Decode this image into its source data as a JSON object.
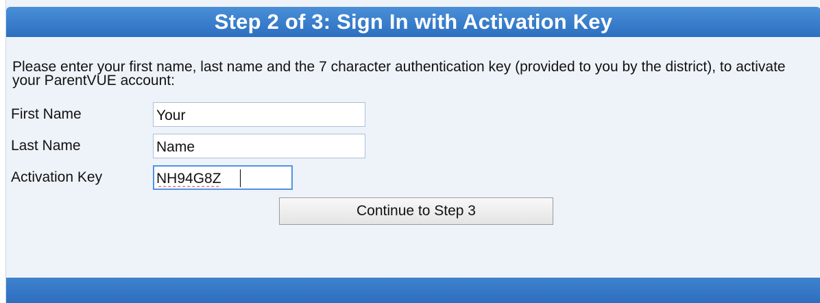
{
  "header": {
    "title": "Step 2 of 3: Sign In with Activation Key"
  },
  "instructions": "Please enter your first name, last name and the 7 character authentication key (provided to you by the district), to activate your ParentVUE account:",
  "form": {
    "first_name": {
      "label": "First Name",
      "value": "Your"
    },
    "last_name": {
      "label": "Last Name",
      "value": "Name"
    },
    "activation_key": {
      "label": "Activation Key",
      "value": "NH94G8Z"
    }
  },
  "buttons": {
    "continue_label": "Continue to Step 3"
  },
  "colors": {
    "header": "#3a7fcd",
    "panel_background": "#eef3f9",
    "focus_border": "#4f93e3"
  }
}
